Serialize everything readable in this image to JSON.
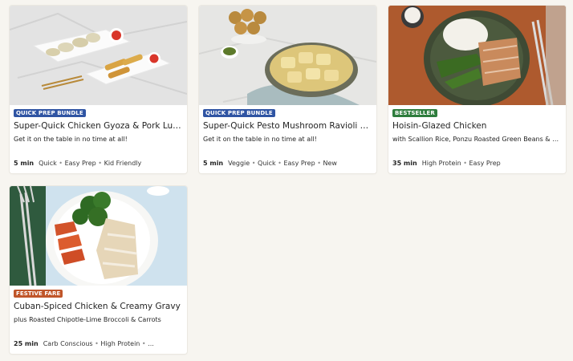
{
  "colors": {
    "quick_prep_badge": "#2f54a3",
    "bestseller_badge": "#2e7d3d",
    "festive_badge": "#c0562a",
    "page_background": "#f7f5f0"
  },
  "cards": [
    {
      "badge": "QUICK PREP BUNDLE",
      "title": "Super-Quick Chicken Gyoza & Pork Lum...",
      "subtitle": "Get it on the table in no time at all!",
      "time": "5 min",
      "tags": [
        "Quick",
        "Easy Prep",
        "Kid Friendly"
      ]
    },
    {
      "badge": "QUICK PREP BUNDLE",
      "title": "Super-Quick Pesto Mushroom Ravioli & ...",
      "subtitle": "Get it on the table in no time at all!",
      "time": "5 min",
      "tags": [
        "Veggie",
        "Quick",
        "Easy Prep",
        "New"
      ]
    },
    {
      "badge": "BESTSELLER",
      "title": "Hoisin-Glazed Chicken",
      "subtitle": "with Scallion Rice, Ponzu Roasted Green Beans & Sr...",
      "time": "35 min",
      "tags": [
        "High Protein",
        "Easy Prep"
      ]
    },
    {
      "badge": "FESTIVE FARE",
      "title": "Cuban-Spiced Chicken & Creamy Gravy",
      "subtitle": "plus Roasted Chipotle-Lime Broccoli & Carrots",
      "time": "25 min",
      "tags": [
        "Carb Conscious",
        "High Protein",
        "..."
      ]
    }
  ]
}
